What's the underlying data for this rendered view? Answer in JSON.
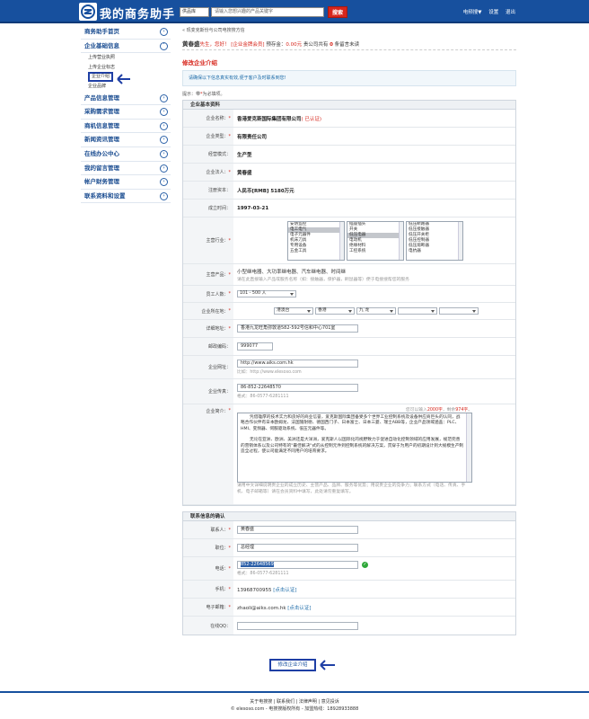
{
  "header": {
    "logo_text": "我的商务助手",
    "search_scope": "供品库",
    "search_placeholder": "请输入您想兴趣的产品关键字",
    "search_button": "搜索",
    "links": [
      "电频搜▼",
      "设置",
      "退出"
    ]
  },
  "sidebar": {
    "menus": [
      {
        "label": "商务助手首页"
      },
      {
        "label": "企业基础信息",
        "sub": [
          "上传营业执照",
          "上传企业标志",
          "企业介绍",
          "企业品牌"
        ]
      },
      {
        "label": "产品信息管理"
      },
      {
        "label": "采购需求管理"
      },
      {
        "label": "商机信息管理"
      },
      {
        "label": "新闻资讯管理"
      },
      {
        "label": "在线办公中心"
      },
      {
        "label": "我的留言管理"
      },
      {
        "label": "帐户财务管理"
      },
      {
        "label": "联系资料和设置"
      }
    ]
  },
  "main": {
    "breadcrumb": "« 现变克斯份与公司电搜搜方信",
    "greeting": {
      "name": "黄春盛",
      "suffix": "先生，您好！",
      "member": "[企业金牌会员]",
      "balance_label": "预存金：",
      "balance": "0.00元",
      "msg_pre": "贵公司共有",
      "msg_count": "0",
      "msg_post": "条留言未读"
    },
    "section_title": "修改企业介绍",
    "notice": "请确保以下信息真实有效,便于客户及时联系到您!",
    "tip_pre": "提示：带",
    "tip_star": "*",
    "tip_post": "为必填项。"
  },
  "form": {
    "group1": "企业基本资料",
    "group2": "联系信息的确认",
    "company_name_label": "企业名称：",
    "company_name": "香港爱克斯国际集团有限公司",
    "verified": "( 已认证)",
    "company_type_label": "企业类型：",
    "company_type": "有限责任公司",
    "mode_label": "经营模式：",
    "mode": "生产型",
    "legal_label": "企业法人：",
    "legal": "黄春盛",
    "capital_label": "注册资本：",
    "capital": "人民币[RMB] 5180万元",
    "founded_label": "成立时间：",
    "founded": "1997-03-21",
    "industry_label": "主营行业：",
    "industry_col1": [
      "安防监控",
      "电工电气",
      "电子元器件",
      "机床刀具",
      "专用设备",
      "五金工具"
    ],
    "industry_col2": [
      "插座插头",
      "开关",
      "低压电器",
      "电动机",
      "绝缘材料",
      "工控系统"
    ],
    "industry_col3": [
      "低压断路器",
      "低压接触器",
      "低压开关柜",
      "低压控制器",
      "低压熔断器",
      "电抗器"
    ],
    "products_label": "主营产品：",
    "products": "小型继电器、大功率继电器、汽车继电器、时间继",
    "products_hint": "请在此直接输入产品或服务名称（如：接触器，保护器，刷鼠器等）便于电搜搜帮您的服务",
    "staff_label": "员工人数：",
    "staff": "101 - 500 人",
    "region_label": "企业所在地：",
    "region": [
      "港澳台",
      "香港",
      "九 龙",
      "",
      ""
    ],
    "address_label": "详细地址：",
    "address": "香港九龙旺角弥敦道582-592号信和中心701室",
    "zip_label": "邮政编码：",
    "zip": "999077",
    "website_label": "企业网址：",
    "website": "http://www.aiks.com.hk",
    "website_hint": "比如：http://www.elesoso.com",
    "fax_label": "企业传真：",
    "fax": "86-852-22648570",
    "fax_hint": "格式：86-0577-6281111",
    "intro_label": "企业简介：",
    "intro_count_pre": "您可以输入",
    "intro_count_max": "2000字",
    "intro_count_mid": "，剩余",
    "intro_count_left": "974字",
    "intro_count_post": "。",
    "intro_p1": "凭借雄厚的技术实力和良好的商业信誉，爱克斯国际集团备受多个世界工业控制系统及设备供应商巨头的认同，战略合作伙伴有日本欧姆龙、法国施耐德、德国西门子、日本富士、日本三菱、瑞士ABB等，企业产品领域涵盖：PLC、HMI、变频器、伺服驱动系统、低压元器件等。",
    "intro_p2": "无论在亚洲、欧洲、美洲还是大洋洲，爱克斯人以国际化的视野致力于促进自动化控制领域的应用发展，规范完善的营销体系以及公司特有的\"最佳解决\"式的从控制元件到控制系统的解决方案，贯穿于为用户的初期设计到大规模生产制造全过程，使公司能满足不同用户的培育要求。",
    "intro_hint": "请用中文详细说明贵企业的成立历史、主营产品、品牌、服务等优势；用说贵企业的竞争力；联系方式（电话、传真、手机、电子邮箱等）请在会员资料中填写，此处请勿重复填写。",
    "contact_label": "联系人：",
    "contact": "黄春盛",
    "position_label": "职位：",
    "position": "总经理",
    "phone_label": "电话：",
    "phone": "852-22648569",
    "phone_hint": "格式：86-0577-6281111",
    "mobile_label": "手机：",
    "mobile": "13968700955",
    "mobile_verify": "[点击认证]",
    "email_label": "电子邮箱：",
    "email": "zhaoli@aiks.com.hk",
    "email_verify": "[点击认证]",
    "qq_label": "在线QQ：",
    "qq": "",
    "submit": "修改企业介绍"
  },
  "footer": {
    "links": "关于电搜搜 | 联系我们 | 法律声明 | 意见投诉",
    "copyright": "© elesoso.com - 电搜搜版权所有 - 加盟热线：18928933888"
  }
}
